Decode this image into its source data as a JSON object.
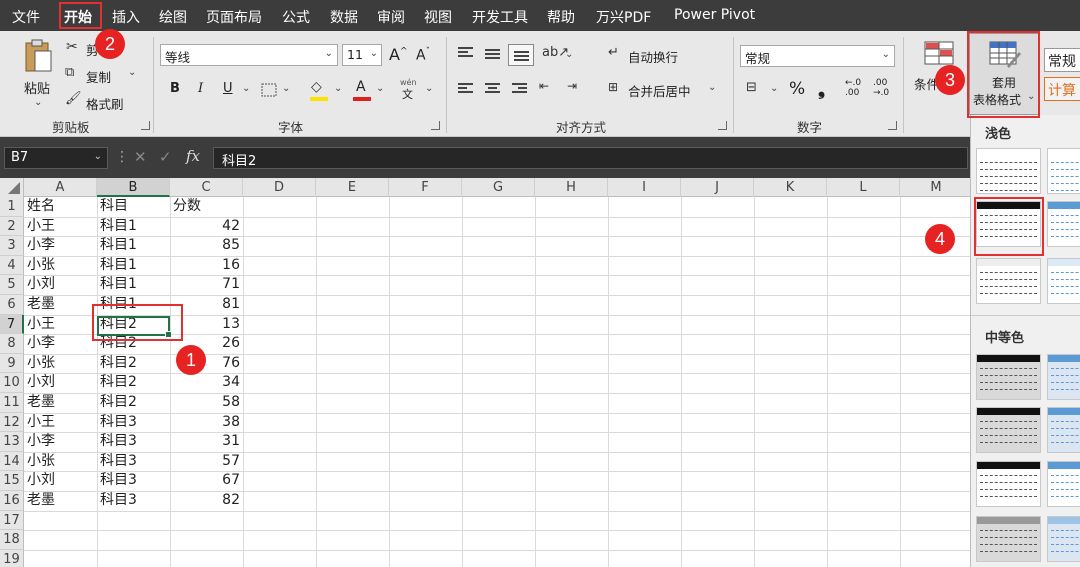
{
  "menubar": {
    "tabs": [
      "文件",
      "开始",
      "插入",
      "绘图",
      "页面布局",
      "公式",
      "数据",
      "审阅",
      "视图",
      "开发工具",
      "帮助",
      "万兴PDF",
      "Power Pivot"
    ],
    "active": "开始"
  },
  "ribbon": {
    "clipboard": {
      "paste": "粘贴",
      "cut": "剪",
      "copy": "复制",
      "format_painter": "格式刷",
      "label": "剪贴板"
    },
    "font": {
      "name": "等线",
      "size": "11",
      "grow": "A",
      "shrink": "A",
      "bold": "B",
      "italic": "I",
      "underline": "U",
      "font_color": "A",
      "wen_top": "wén",
      "wen_bottom": "文",
      "label": "字体"
    },
    "alignment": {
      "wrap": "自动换行",
      "merge": "合并后居中",
      "label": "对齐方式"
    },
    "number": {
      "format": "常规",
      "percent": "%",
      "comma": "❟",
      "inc_decimal": "←.0\n.00",
      "dec_decimal": ".00\n→.0",
      "label": "数字"
    },
    "styles": {
      "conditional": "条件",
      "table_format_line1": "套用",
      "table_format_line2": "表格格式",
      "cell_style_normal": "常规",
      "cell_style_calc": "计算"
    }
  },
  "formula_bar": {
    "name_box": "B7",
    "fx": "fx",
    "value": "科目2"
  },
  "grid": {
    "columns": [
      "A",
      "B",
      "C",
      "D",
      "E",
      "F",
      "G",
      "H",
      "I",
      "J",
      "K",
      "L",
      "M"
    ],
    "selected_column": "B",
    "rows": [
      "1",
      "2",
      "3",
      "4",
      "5",
      "6",
      "7",
      "8",
      "9",
      "10",
      "11",
      "12",
      "13",
      "14",
      "15",
      "16",
      "17",
      "18",
      "19"
    ],
    "selected_row": "7",
    "header": [
      "姓名",
      "科目",
      "分数"
    ],
    "data": [
      [
        "小王",
        "科目1",
        "42"
      ],
      [
        "小李",
        "科目1",
        "85"
      ],
      [
        "小张",
        "科目1",
        "16"
      ],
      [
        "小刘",
        "科目1",
        "71"
      ],
      [
        "老墨",
        "科目1",
        "81"
      ],
      [
        "小王",
        "科目2",
        "13"
      ],
      [
        "小李",
        "科目2",
        "26"
      ],
      [
        "小张",
        "科目2",
        "76"
      ],
      [
        "小刘",
        "科目2",
        "34"
      ],
      [
        "老墨",
        "科目2",
        "58"
      ],
      [
        "小王",
        "科目3",
        "38"
      ],
      [
        "小李",
        "科目3",
        "31"
      ],
      [
        "小张",
        "科目3",
        "57"
      ],
      [
        "小刘",
        "科目3",
        "67"
      ],
      [
        "老墨",
        "科目3",
        "82"
      ]
    ]
  },
  "gallery": {
    "light_label": "浅色",
    "medium_label": "中等色"
  },
  "annotations": {
    "b1": "1",
    "b2": "2",
    "b3": "3",
    "b4": "4"
  },
  "colors": {
    "accent_green": "#217346",
    "annotation_red": "#e62222",
    "menubar": "#3c3c3c"
  }
}
